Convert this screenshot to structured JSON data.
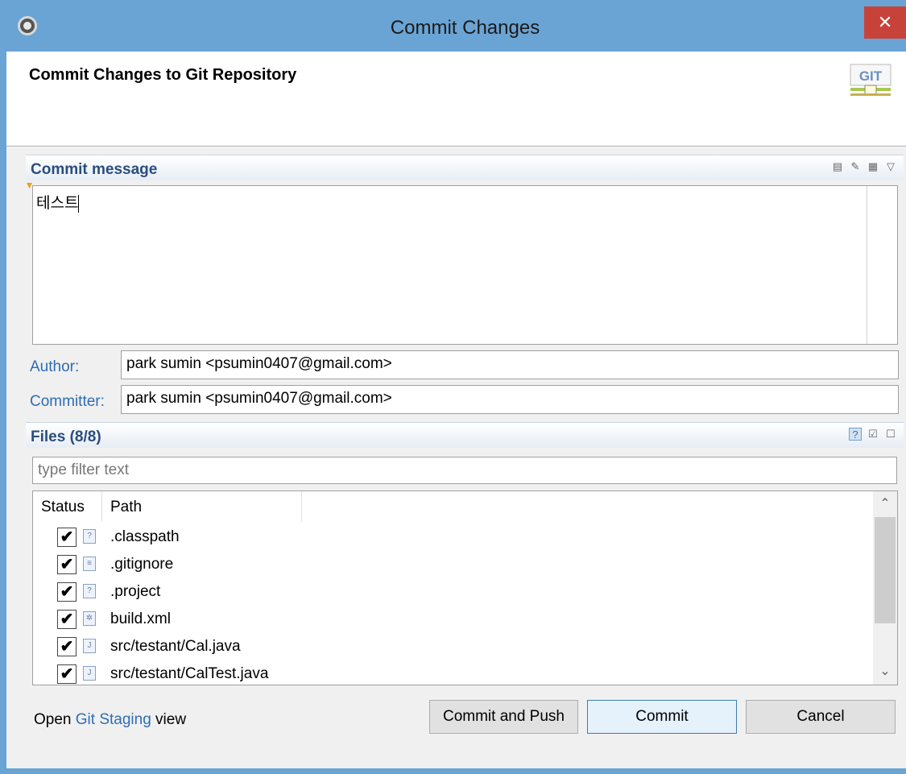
{
  "window": {
    "title": "Commit Changes",
    "close_glyph": "✕"
  },
  "header": {
    "title": "Commit Changes to Git Repository",
    "logo_text": "GIT"
  },
  "commit_message": {
    "section_title": "Commit message",
    "text": "테스트"
  },
  "author": {
    "label": "Author:",
    "value": "park sumin <psumin0407@gmail.com>"
  },
  "committer": {
    "label": "Committer:",
    "value": "park sumin <psumin0407@gmail.com>"
  },
  "files": {
    "section_title": "Files (8/8)",
    "filter_placeholder": "type filter text",
    "columns": [
      "Status",
      "Path"
    ],
    "rows": [
      {
        "checked": true,
        "path": ".classpath"
      },
      {
        "checked": true,
        "path": ".gitignore"
      },
      {
        "checked": true,
        "path": ".project"
      },
      {
        "checked": true,
        "path": "build.xml"
      },
      {
        "checked": true,
        "path": "src/testant/Cal.java"
      },
      {
        "checked": true,
        "path": "src/testant/CalTest.java"
      }
    ]
  },
  "footer": {
    "open_prefix": "Open ",
    "staging_link": "Git Staging",
    "view_suffix": " view"
  },
  "buttons": {
    "commit_and_push": "Commit and Push",
    "commit": "Commit",
    "cancel": "Cancel"
  },
  "colors": {
    "titlebar": "#6aa4d4",
    "close": "#c7433a",
    "link": "#2e6db4"
  }
}
